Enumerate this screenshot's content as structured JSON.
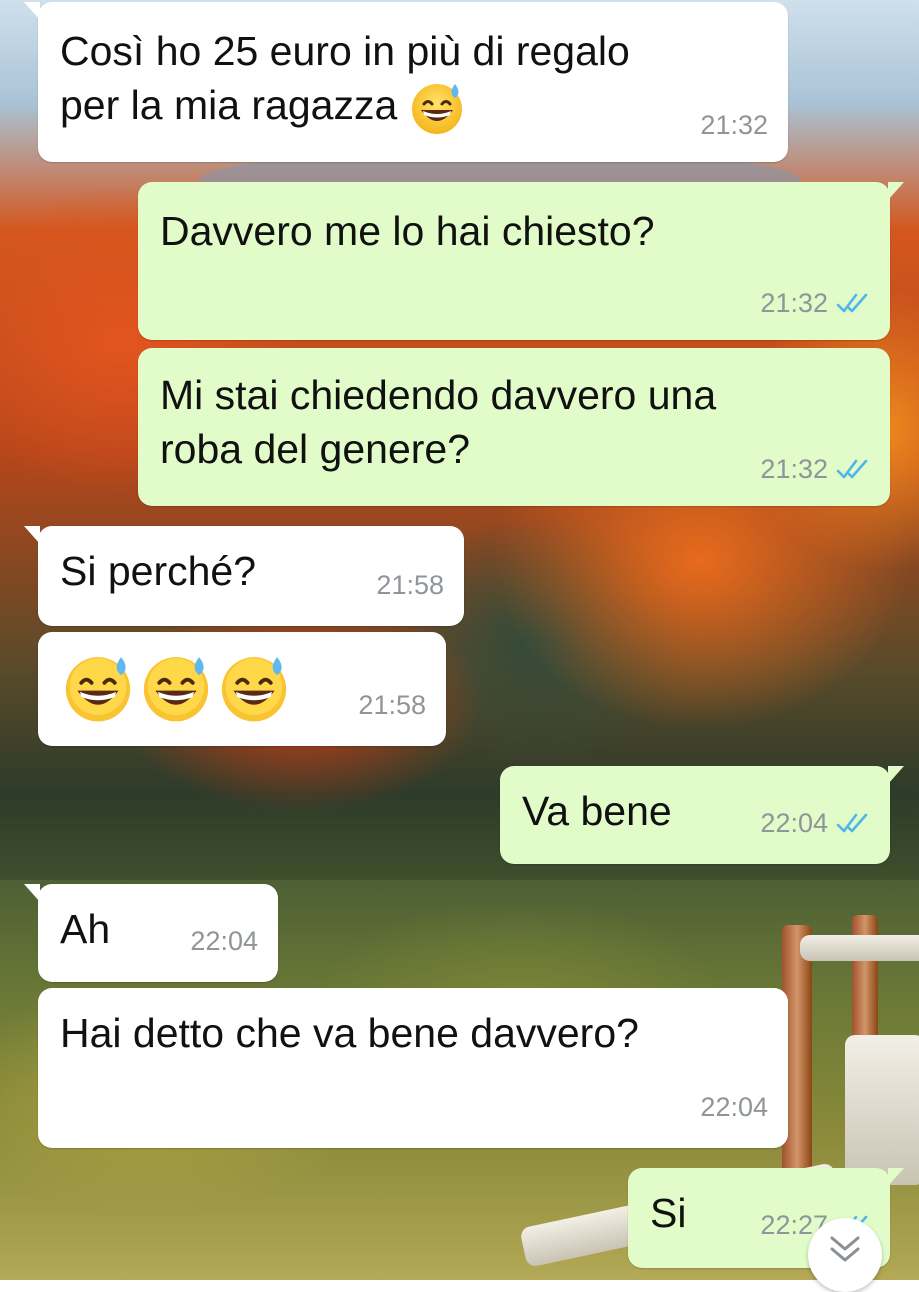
{
  "messages": [
    {
      "direction": "incoming",
      "text": "Così ho 25 euro in più di regalo\nper la mia ragazza",
      "emoji": [
        "grinning-face-with-sweat"
      ],
      "time": "21:32"
    },
    {
      "direction": "outgoing",
      "text": "Davvero me lo hai chiesto?",
      "time": "21:32",
      "status": "read"
    },
    {
      "direction": "outgoing",
      "text": "Mi stai chiedendo davvero una\nroba del genere?",
      "time": "21:32",
      "status": "read"
    },
    {
      "direction": "incoming",
      "text": "Si perché?",
      "time": "21:58"
    },
    {
      "direction": "incoming",
      "text": "",
      "emoji": [
        "grinning-face-with-sweat",
        "grinning-face-with-sweat",
        "grinning-face-with-sweat"
      ],
      "time": "21:58"
    },
    {
      "direction": "outgoing",
      "text": "Va bene",
      "time": "22:04",
      "status": "read"
    },
    {
      "direction": "incoming",
      "text": "Ah",
      "time": "22:04"
    },
    {
      "direction": "incoming",
      "text": "Hai detto che va bene davvero?",
      "time": "22:04"
    },
    {
      "direction": "outgoing",
      "text": "Si",
      "time": "22:27",
      "status": "read"
    }
  ],
  "colors": {
    "incoming_bubble": "#ffffff",
    "outgoing_bubble": "#e1fcc9",
    "timestamp": "#8f9599",
    "read_ticks": "#4fb6ec"
  },
  "icons": {
    "read_receipt": "double-check-icon",
    "scroll_down": "chevron-double-down-icon"
  }
}
